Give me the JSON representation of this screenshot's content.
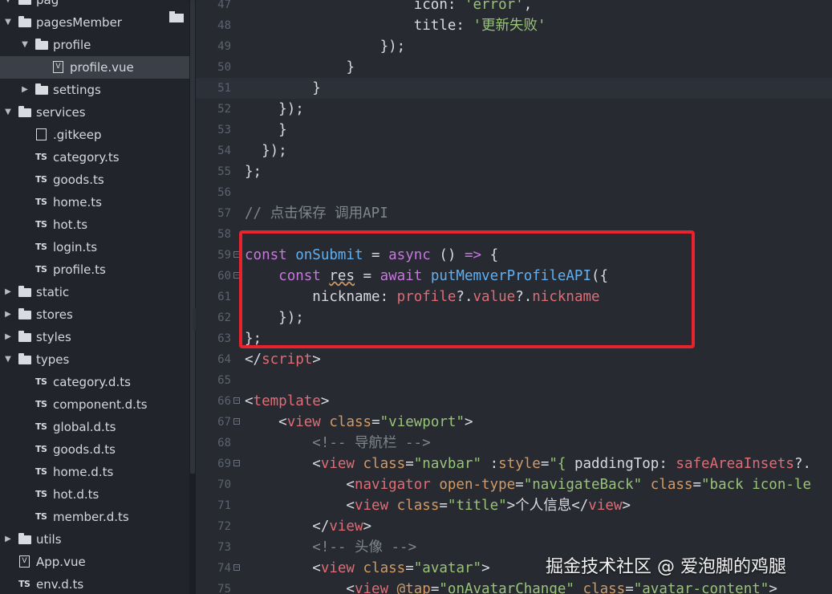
{
  "explorer": {
    "items": [
      {
        "label": "pag",
        "type": "folder",
        "level": 0,
        "expanded": true
      },
      {
        "label": "pagesMember",
        "type": "folder",
        "level": 0,
        "expanded": true
      },
      {
        "label": "profile",
        "type": "folder",
        "level": 1,
        "expanded": true
      },
      {
        "label": "profile.vue",
        "type": "vue",
        "level": 2,
        "selected": true
      },
      {
        "label": "settings",
        "type": "folder",
        "level": 1,
        "expanded": false
      },
      {
        "label": "services",
        "type": "folder",
        "level": 0,
        "expanded": true
      },
      {
        "label": ".gitkeep",
        "type": "file",
        "level": 1
      },
      {
        "label": "category.ts",
        "type": "ts",
        "level": 1
      },
      {
        "label": "goods.ts",
        "type": "ts",
        "level": 1
      },
      {
        "label": "home.ts",
        "type": "ts",
        "level": 1
      },
      {
        "label": "hot.ts",
        "type": "ts",
        "level": 1
      },
      {
        "label": "login.ts",
        "type": "ts",
        "level": 1
      },
      {
        "label": "profile.ts",
        "type": "ts",
        "level": 1
      },
      {
        "label": "static",
        "type": "folder",
        "level": 0,
        "expanded": false
      },
      {
        "label": "stores",
        "type": "folder",
        "level": 0,
        "expanded": false
      },
      {
        "label": "styles",
        "type": "folder",
        "level": 0,
        "expanded": false
      },
      {
        "label": "types",
        "type": "folder",
        "level": 0,
        "expanded": true
      },
      {
        "label": "category.d.ts",
        "type": "ts",
        "level": 1
      },
      {
        "label": "component.d.ts",
        "type": "ts",
        "level": 1
      },
      {
        "label": "global.d.ts",
        "type": "ts",
        "level": 1
      },
      {
        "label": "goods.d.ts",
        "type": "ts",
        "level": 1
      },
      {
        "label": "home.d.ts",
        "type": "ts",
        "level": 1
      },
      {
        "label": "hot.d.ts",
        "type": "ts",
        "level": 1
      },
      {
        "label": "member.d.ts",
        "type": "ts",
        "level": 1
      },
      {
        "label": "utils",
        "type": "folder",
        "level": 0,
        "expanded": false
      },
      {
        "label": "App.vue",
        "type": "vue",
        "level": 0
      },
      {
        "label": "env.d.ts",
        "type": "ts",
        "level": 0
      }
    ],
    "ts_badge": "TS",
    "vue_badge": "V"
  },
  "editor": {
    "collapse_glyph": "‹",
    "lines": [
      {
        "n": "47",
        "t": [
          [
            "p",
            "                    "
          ],
          [
            "p",
            "icon: "
          ],
          [
            "str",
            "'error'"
          ],
          [
            "p",
            ","
          ]
        ]
      },
      {
        "n": "48",
        "t": [
          [
            "p",
            "                    "
          ],
          [
            "p",
            "title: "
          ],
          [
            "str",
            "'更新失败'"
          ]
        ]
      },
      {
        "n": "49",
        "t": [
          [
            "p",
            "                "
          ],
          [
            "p",
            "});"
          ]
        ]
      },
      {
        "n": "50",
        "t": [
          [
            "p",
            "            "
          ],
          [
            "p",
            "}"
          ]
        ]
      },
      {
        "n": "51",
        "active": true,
        "t": [
          [
            "p",
            "        "
          ],
          [
            "p",
            "}"
          ]
        ]
      },
      {
        "n": "52",
        "t": [
          [
            "p",
            "    "
          ],
          [
            "p",
            "});"
          ]
        ]
      },
      {
        "n": "53",
        "t": [
          [
            "p",
            "    "
          ],
          [
            "p",
            "}"
          ]
        ]
      },
      {
        "n": "54",
        "t": [
          [
            "p",
            "  "
          ],
          [
            "p",
            "});"
          ]
        ]
      },
      {
        "n": "55",
        "t": [
          [
            "p",
            "};"
          ]
        ]
      },
      {
        "n": "56",
        "t": []
      },
      {
        "n": "57",
        "t": [
          [
            "cm",
            "// 点击保存 调用API"
          ]
        ]
      },
      {
        "n": "58",
        "t": []
      },
      {
        "n": "59",
        "fold": true,
        "t": [
          [
            "k",
            "const "
          ],
          [
            "fn",
            "onSubmit"
          ],
          [
            "p",
            " = "
          ],
          [
            "k",
            "async"
          ],
          [
            "p",
            " () "
          ],
          [
            "k",
            "=>"
          ],
          [
            "p",
            " {"
          ]
        ]
      },
      {
        "n": "60",
        "fold": true,
        "t": [
          [
            "p",
            "    "
          ],
          [
            "k",
            "const "
          ],
          [
            "ul",
            "res"
          ],
          [
            "p",
            " = "
          ],
          [
            "k",
            "await "
          ],
          [
            "fn",
            "putMemverProfileAPI"
          ],
          [
            "p",
            "({"
          ]
        ]
      },
      {
        "n": "61",
        "t": [
          [
            "p",
            "        "
          ],
          [
            "p",
            "nickname: "
          ],
          [
            "prop",
            "profile"
          ],
          [
            "p",
            "?."
          ],
          [
            "prop",
            "value"
          ],
          [
            "p",
            "?."
          ],
          [
            "prop",
            "nickname"
          ]
        ]
      },
      {
        "n": "62",
        "t": [
          [
            "p",
            "    "
          ],
          [
            "p",
            "});"
          ]
        ]
      },
      {
        "n": "63",
        "t": [
          [
            "p",
            "};"
          ]
        ]
      },
      {
        "n": "64",
        "t": [
          [
            "p",
            "</"
          ],
          [
            "tag",
            "script"
          ],
          [
            "p",
            ">"
          ]
        ]
      },
      {
        "n": "65",
        "t": []
      },
      {
        "n": "66",
        "fold": true,
        "t": [
          [
            "p",
            "<"
          ],
          [
            "tag",
            "template"
          ],
          [
            "p",
            ">"
          ]
        ]
      },
      {
        "n": "67",
        "fold": true,
        "t": [
          [
            "p",
            "    <"
          ],
          [
            "tag",
            "view"
          ],
          [
            "p",
            " "
          ],
          [
            "at",
            "class"
          ],
          [
            "p",
            "="
          ],
          [
            "str",
            "\"viewport\""
          ],
          [
            "p",
            ">"
          ]
        ]
      },
      {
        "n": "68",
        "t": [
          [
            "p",
            "        "
          ],
          [
            "cm",
            "<!-- 导航栏 -->"
          ]
        ]
      },
      {
        "n": "69",
        "fold": true,
        "t": [
          [
            "p",
            "        <"
          ],
          [
            "tag",
            "view"
          ],
          [
            "p",
            " "
          ],
          [
            "at",
            "class"
          ],
          [
            "p",
            "="
          ],
          [
            "str",
            "\"navbar\""
          ],
          [
            "p",
            " :"
          ],
          [
            "at",
            "style"
          ],
          [
            "p",
            "="
          ],
          [
            "str",
            "\"{ "
          ],
          [
            "p",
            "paddingTop: "
          ],
          [
            "prop",
            "safeAreaInsets"
          ],
          [
            "p",
            "?."
          ]
        ]
      },
      {
        "n": "70",
        "t": [
          [
            "p",
            "            <"
          ],
          [
            "tag",
            "navigator"
          ],
          [
            "p",
            " "
          ],
          [
            "at",
            "open-type"
          ],
          [
            "p",
            "="
          ],
          [
            "str",
            "\"navigateBack\""
          ],
          [
            "p",
            " "
          ],
          [
            "at",
            "class"
          ],
          [
            "p",
            "="
          ],
          [
            "str",
            "\"back icon-le"
          ]
        ]
      },
      {
        "n": "71",
        "t": [
          [
            "p",
            "            <"
          ],
          [
            "tag",
            "view"
          ],
          [
            "p",
            " "
          ],
          [
            "at",
            "class"
          ],
          [
            "p",
            "="
          ],
          [
            "str",
            "\"title\""
          ],
          [
            "p",
            ">个人信息</"
          ],
          [
            "tag",
            "view"
          ],
          [
            "p",
            ">"
          ]
        ]
      },
      {
        "n": "72",
        "t": [
          [
            "p",
            "        </"
          ],
          [
            "tag",
            "view"
          ],
          [
            "p",
            ">"
          ]
        ]
      },
      {
        "n": "73",
        "t": [
          [
            "p",
            "        "
          ],
          [
            "cm",
            "<!-- 头像 -->"
          ]
        ]
      },
      {
        "n": "74",
        "fold": true,
        "t": [
          [
            "p",
            "        <"
          ],
          [
            "tag",
            "view"
          ],
          [
            "p",
            " "
          ],
          [
            "at",
            "class"
          ],
          [
            "p",
            "="
          ],
          [
            "str",
            "\"avatar\""
          ],
          [
            "p",
            ">"
          ]
        ]
      },
      {
        "n": "75",
        "t": [
          [
            "p",
            "            <"
          ],
          [
            "tag",
            "view"
          ],
          [
            "p",
            " "
          ],
          [
            "at",
            "@tap"
          ],
          [
            "p",
            "="
          ],
          [
            "str",
            "\"onAvatarChange\""
          ],
          [
            "p",
            " "
          ],
          [
            "at",
            "class"
          ],
          [
            "p",
            "="
          ],
          [
            "str",
            "\"avatar-content\""
          ],
          [
            "p",
            ">"
          ]
        ]
      }
    ]
  },
  "watermark": "掘金技术社区 @ 爱泡脚的鸡腿",
  "colors": {
    "highlight_border": "#e8232e",
    "editor_bg": "#272a30",
    "sidebar_bg": "#21252b"
  }
}
